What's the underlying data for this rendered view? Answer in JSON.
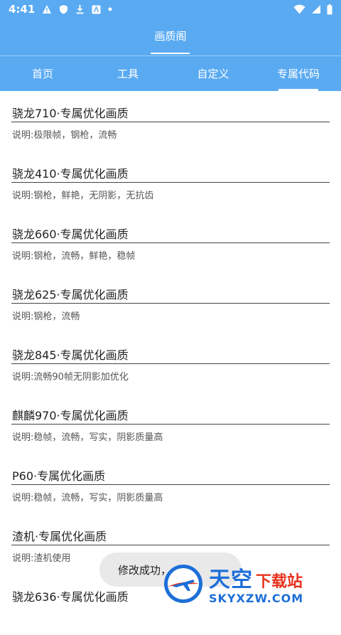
{
  "status_bar": {
    "time": "4:41",
    "icons": [
      "alert-icon",
      "shield-icon",
      "download-icon",
      "a-box-icon",
      "dot-icon"
    ],
    "right_icons": [
      "wifi-icon",
      "signal-icon",
      "battery-icon"
    ]
  },
  "header": {
    "title": "画质阁"
  },
  "tabs": [
    {
      "label": "首页"
    },
    {
      "label": "工具"
    },
    {
      "label": "自定义"
    },
    {
      "label": "专属代码",
      "active": true
    }
  ],
  "items": [
    {
      "name": "骁龙710·专属优化画质",
      "desc": "说明:极限帧，钢枪，流畅"
    },
    {
      "name": "骁龙410·专属优化画质",
      "desc": "说明:钢枪，鲜艳，无阴影，无抗齿"
    },
    {
      "name": "骁龙660·专属优化画质",
      "desc": "说明:钢枪，流畅，鲜艳，稳帧"
    },
    {
      "name": "骁龙625·专属优化画质",
      "desc": "说明:钢枪，流畅"
    },
    {
      "name": "骁龙845·专属优化画质",
      "desc": "说明:流畅90帧无阴影加优化"
    },
    {
      "name": "麒麟970·专属优化画质",
      "desc": "说明:稳帧，流畅，写实，阴影质量高"
    },
    {
      "name": "P60·专属优化画质",
      "desc": "说明:稳帧，流畅，写实，阴影质量高"
    },
    {
      "name": "渣机·专属优化画质",
      "desc": "说明:渣机使用"
    },
    {
      "name": "骁龙636·专属优化画质",
      "desc": ""
    }
  ],
  "toast": {
    "text": "修改成功，"
  },
  "watermark": {
    "cn": "天空",
    "cn2": "下载站",
    "en": "SKYXZW.COM"
  },
  "colors": {
    "primary": "#5aaaf2",
    "watermark_blue": "#1d6fd8",
    "watermark_red": "#e8321e"
  }
}
